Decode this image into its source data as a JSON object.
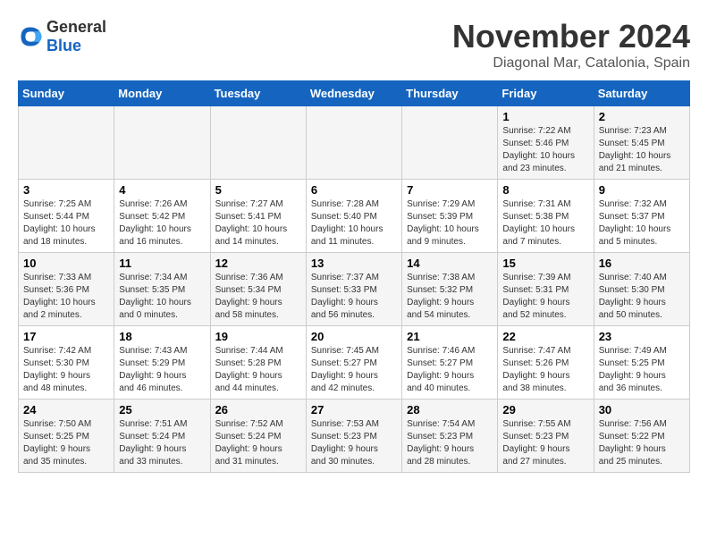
{
  "logo": {
    "general": "General",
    "blue": "Blue"
  },
  "title": "November 2024",
  "location": "Diagonal Mar, Catalonia, Spain",
  "headers": [
    "Sunday",
    "Monday",
    "Tuesday",
    "Wednesday",
    "Thursday",
    "Friday",
    "Saturday"
  ],
  "weeks": [
    [
      {
        "day": "",
        "info": ""
      },
      {
        "day": "",
        "info": ""
      },
      {
        "day": "",
        "info": ""
      },
      {
        "day": "",
        "info": ""
      },
      {
        "day": "",
        "info": ""
      },
      {
        "day": "1",
        "info": "Sunrise: 7:22 AM\nSunset: 5:46 PM\nDaylight: 10 hours\nand 23 minutes."
      },
      {
        "day": "2",
        "info": "Sunrise: 7:23 AM\nSunset: 5:45 PM\nDaylight: 10 hours\nand 21 minutes."
      }
    ],
    [
      {
        "day": "3",
        "info": "Sunrise: 7:25 AM\nSunset: 5:44 PM\nDaylight: 10 hours\nand 18 minutes."
      },
      {
        "day": "4",
        "info": "Sunrise: 7:26 AM\nSunset: 5:42 PM\nDaylight: 10 hours\nand 16 minutes."
      },
      {
        "day": "5",
        "info": "Sunrise: 7:27 AM\nSunset: 5:41 PM\nDaylight: 10 hours\nand 14 minutes."
      },
      {
        "day": "6",
        "info": "Sunrise: 7:28 AM\nSunset: 5:40 PM\nDaylight: 10 hours\nand 11 minutes."
      },
      {
        "day": "7",
        "info": "Sunrise: 7:29 AM\nSunset: 5:39 PM\nDaylight: 10 hours\nand 9 minutes."
      },
      {
        "day": "8",
        "info": "Sunrise: 7:31 AM\nSunset: 5:38 PM\nDaylight: 10 hours\nand 7 minutes."
      },
      {
        "day": "9",
        "info": "Sunrise: 7:32 AM\nSunset: 5:37 PM\nDaylight: 10 hours\nand 5 minutes."
      }
    ],
    [
      {
        "day": "10",
        "info": "Sunrise: 7:33 AM\nSunset: 5:36 PM\nDaylight: 10 hours\nand 2 minutes."
      },
      {
        "day": "11",
        "info": "Sunrise: 7:34 AM\nSunset: 5:35 PM\nDaylight: 10 hours\nand 0 minutes."
      },
      {
        "day": "12",
        "info": "Sunrise: 7:36 AM\nSunset: 5:34 PM\nDaylight: 9 hours\nand 58 minutes."
      },
      {
        "day": "13",
        "info": "Sunrise: 7:37 AM\nSunset: 5:33 PM\nDaylight: 9 hours\nand 56 minutes."
      },
      {
        "day": "14",
        "info": "Sunrise: 7:38 AM\nSunset: 5:32 PM\nDaylight: 9 hours\nand 54 minutes."
      },
      {
        "day": "15",
        "info": "Sunrise: 7:39 AM\nSunset: 5:31 PM\nDaylight: 9 hours\nand 52 minutes."
      },
      {
        "day": "16",
        "info": "Sunrise: 7:40 AM\nSunset: 5:30 PM\nDaylight: 9 hours\nand 50 minutes."
      }
    ],
    [
      {
        "day": "17",
        "info": "Sunrise: 7:42 AM\nSunset: 5:30 PM\nDaylight: 9 hours\nand 48 minutes."
      },
      {
        "day": "18",
        "info": "Sunrise: 7:43 AM\nSunset: 5:29 PM\nDaylight: 9 hours\nand 46 minutes."
      },
      {
        "day": "19",
        "info": "Sunrise: 7:44 AM\nSunset: 5:28 PM\nDaylight: 9 hours\nand 44 minutes."
      },
      {
        "day": "20",
        "info": "Sunrise: 7:45 AM\nSunset: 5:27 PM\nDaylight: 9 hours\nand 42 minutes."
      },
      {
        "day": "21",
        "info": "Sunrise: 7:46 AM\nSunset: 5:27 PM\nDaylight: 9 hours\nand 40 minutes."
      },
      {
        "day": "22",
        "info": "Sunrise: 7:47 AM\nSunset: 5:26 PM\nDaylight: 9 hours\nand 38 minutes."
      },
      {
        "day": "23",
        "info": "Sunrise: 7:49 AM\nSunset: 5:25 PM\nDaylight: 9 hours\nand 36 minutes."
      }
    ],
    [
      {
        "day": "24",
        "info": "Sunrise: 7:50 AM\nSunset: 5:25 PM\nDaylight: 9 hours\nand 35 minutes."
      },
      {
        "day": "25",
        "info": "Sunrise: 7:51 AM\nSunset: 5:24 PM\nDaylight: 9 hours\nand 33 minutes."
      },
      {
        "day": "26",
        "info": "Sunrise: 7:52 AM\nSunset: 5:24 PM\nDaylight: 9 hours\nand 31 minutes."
      },
      {
        "day": "27",
        "info": "Sunrise: 7:53 AM\nSunset: 5:23 PM\nDaylight: 9 hours\nand 30 minutes."
      },
      {
        "day": "28",
        "info": "Sunrise: 7:54 AM\nSunset: 5:23 PM\nDaylight: 9 hours\nand 28 minutes."
      },
      {
        "day": "29",
        "info": "Sunrise: 7:55 AM\nSunset: 5:23 PM\nDaylight: 9 hours\nand 27 minutes."
      },
      {
        "day": "30",
        "info": "Sunrise: 7:56 AM\nSunset: 5:22 PM\nDaylight: 9 hours\nand 25 minutes."
      }
    ]
  ]
}
